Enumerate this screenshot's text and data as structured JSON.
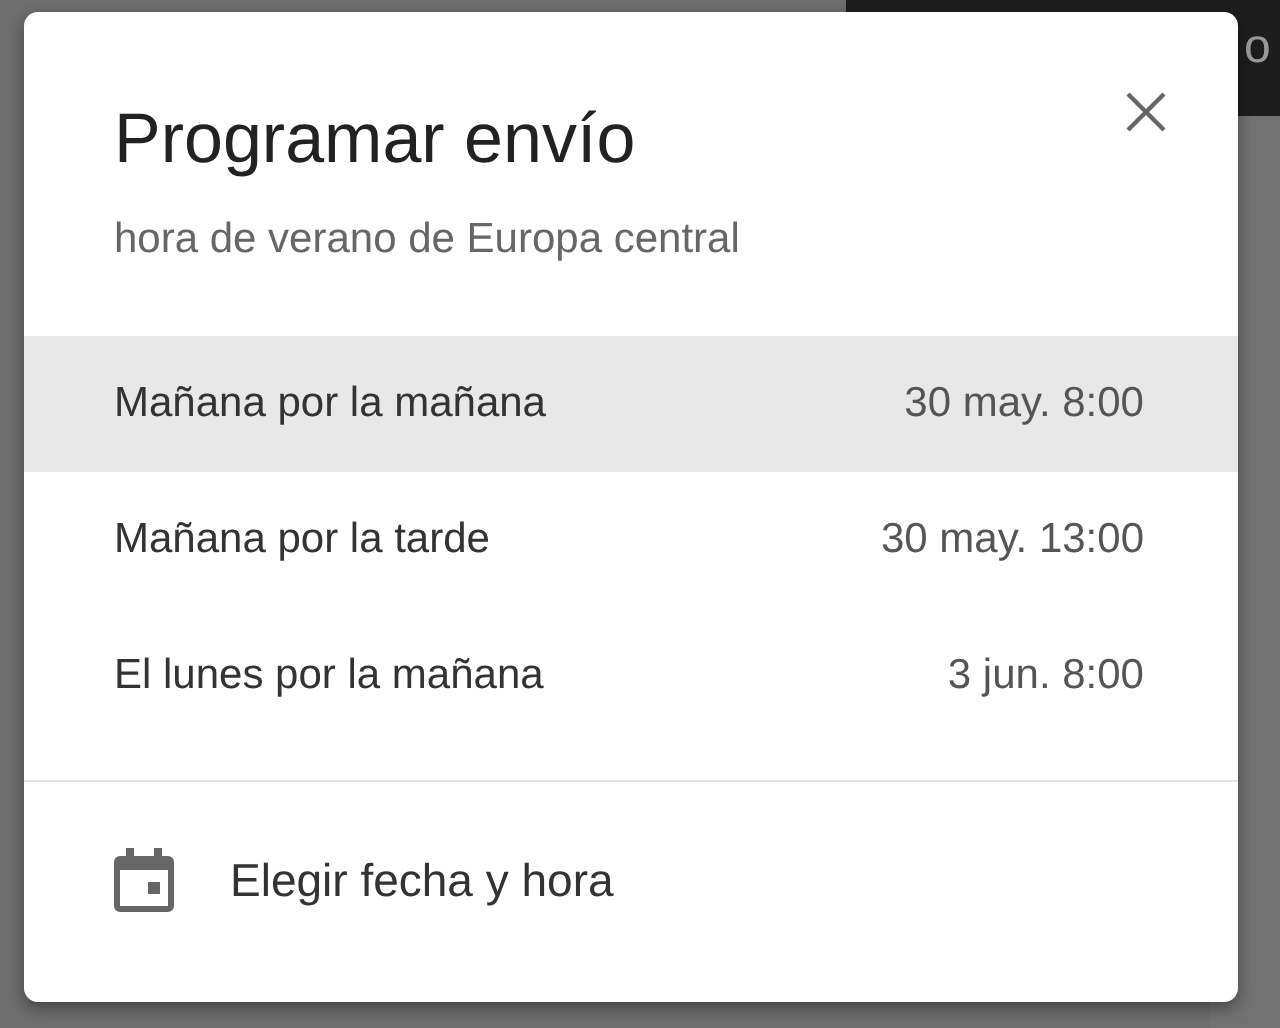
{
  "background": {
    "top_right_text": "o"
  },
  "dialog": {
    "title": "Programar envío",
    "subtitle": "hora de verano de Europa central",
    "options": [
      {
        "label": "Mañana por la mañana",
        "time": "30 may. 8:00",
        "selected": true
      },
      {
        "label": "Mañana por la tarde",
        "time": "30 may. 13:00",
        "selected": false
      },
      {
        "label": "El lunes por la mañana",
        "time": "3 jun. 8:00",
        "selected": false
      }
    ],
    "custom_option": {
      "label": "Elegir fecha y hora"
    }
  }
}
